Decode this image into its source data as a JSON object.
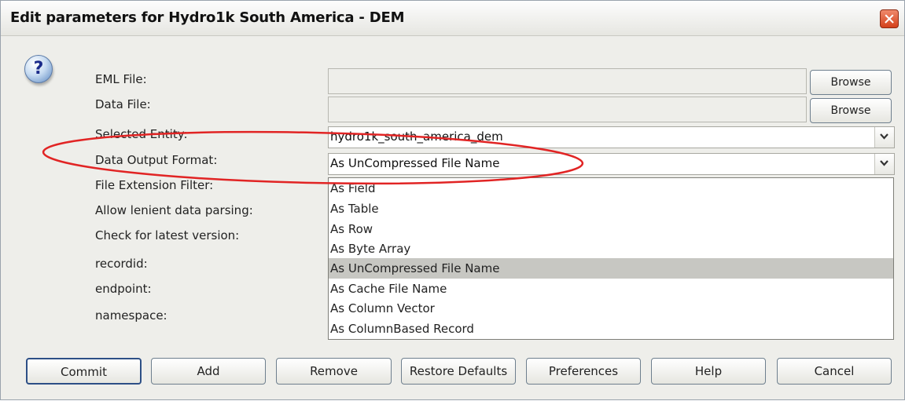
{
  "window": {
    "title": "Edit parameters for Hydro1k South America - DEM"
  },
  "icons": {
    "close": "close-icon",
    "help": "question-icon",
    "dropdown": "chevron-down-icon"
  },
  "colors": {
    "annotation": "#e12424",
    "selected_option": "#c7c7c2"
  },
  "labels": {
    "eml_file": "EML File:",
    "data_file": "Data File:",
    "selected_entity": "Selected Entity:",
    "data_output_format": "Data Output Format:",
    "file_extension_filter": "File Extension Filter:",
    "allow_lenient": "Allow lenient data parsing:",
    "check_latest": "Check for latest version:",
    "recordid": "recordid:",
    "endpoint": "endpoint:",
    "namespace": "namespace:"
  },
  "fields": {
    "eml_file": "",
    "data_file": "",
    "browse_label": "Browse",
    "selected_entity": "hydro1k_south_america_dem",
    "data_output_format": "As UnCompressed File Name"
  },
  "dropdown": {
    "options": [
      "As Field",
      "As Table",
      "As Row",
      "As Byte Array",
      "As UnCompressed File Name",
      "As Cache File Name",
      "As Column Vector",
      "As ColumnBased Record"
    ],
    "selected": "As UnCompressed File Name"
  },
  "buttons": {
    "commit": "Commit",
    "add": "Add",
    "remove": "Remove",
    "restore_defaults": "Restore Defaults",
    "preferences": "Preferences",
    "help": "Help",
    "cancel": "Cancel"
  }
}
